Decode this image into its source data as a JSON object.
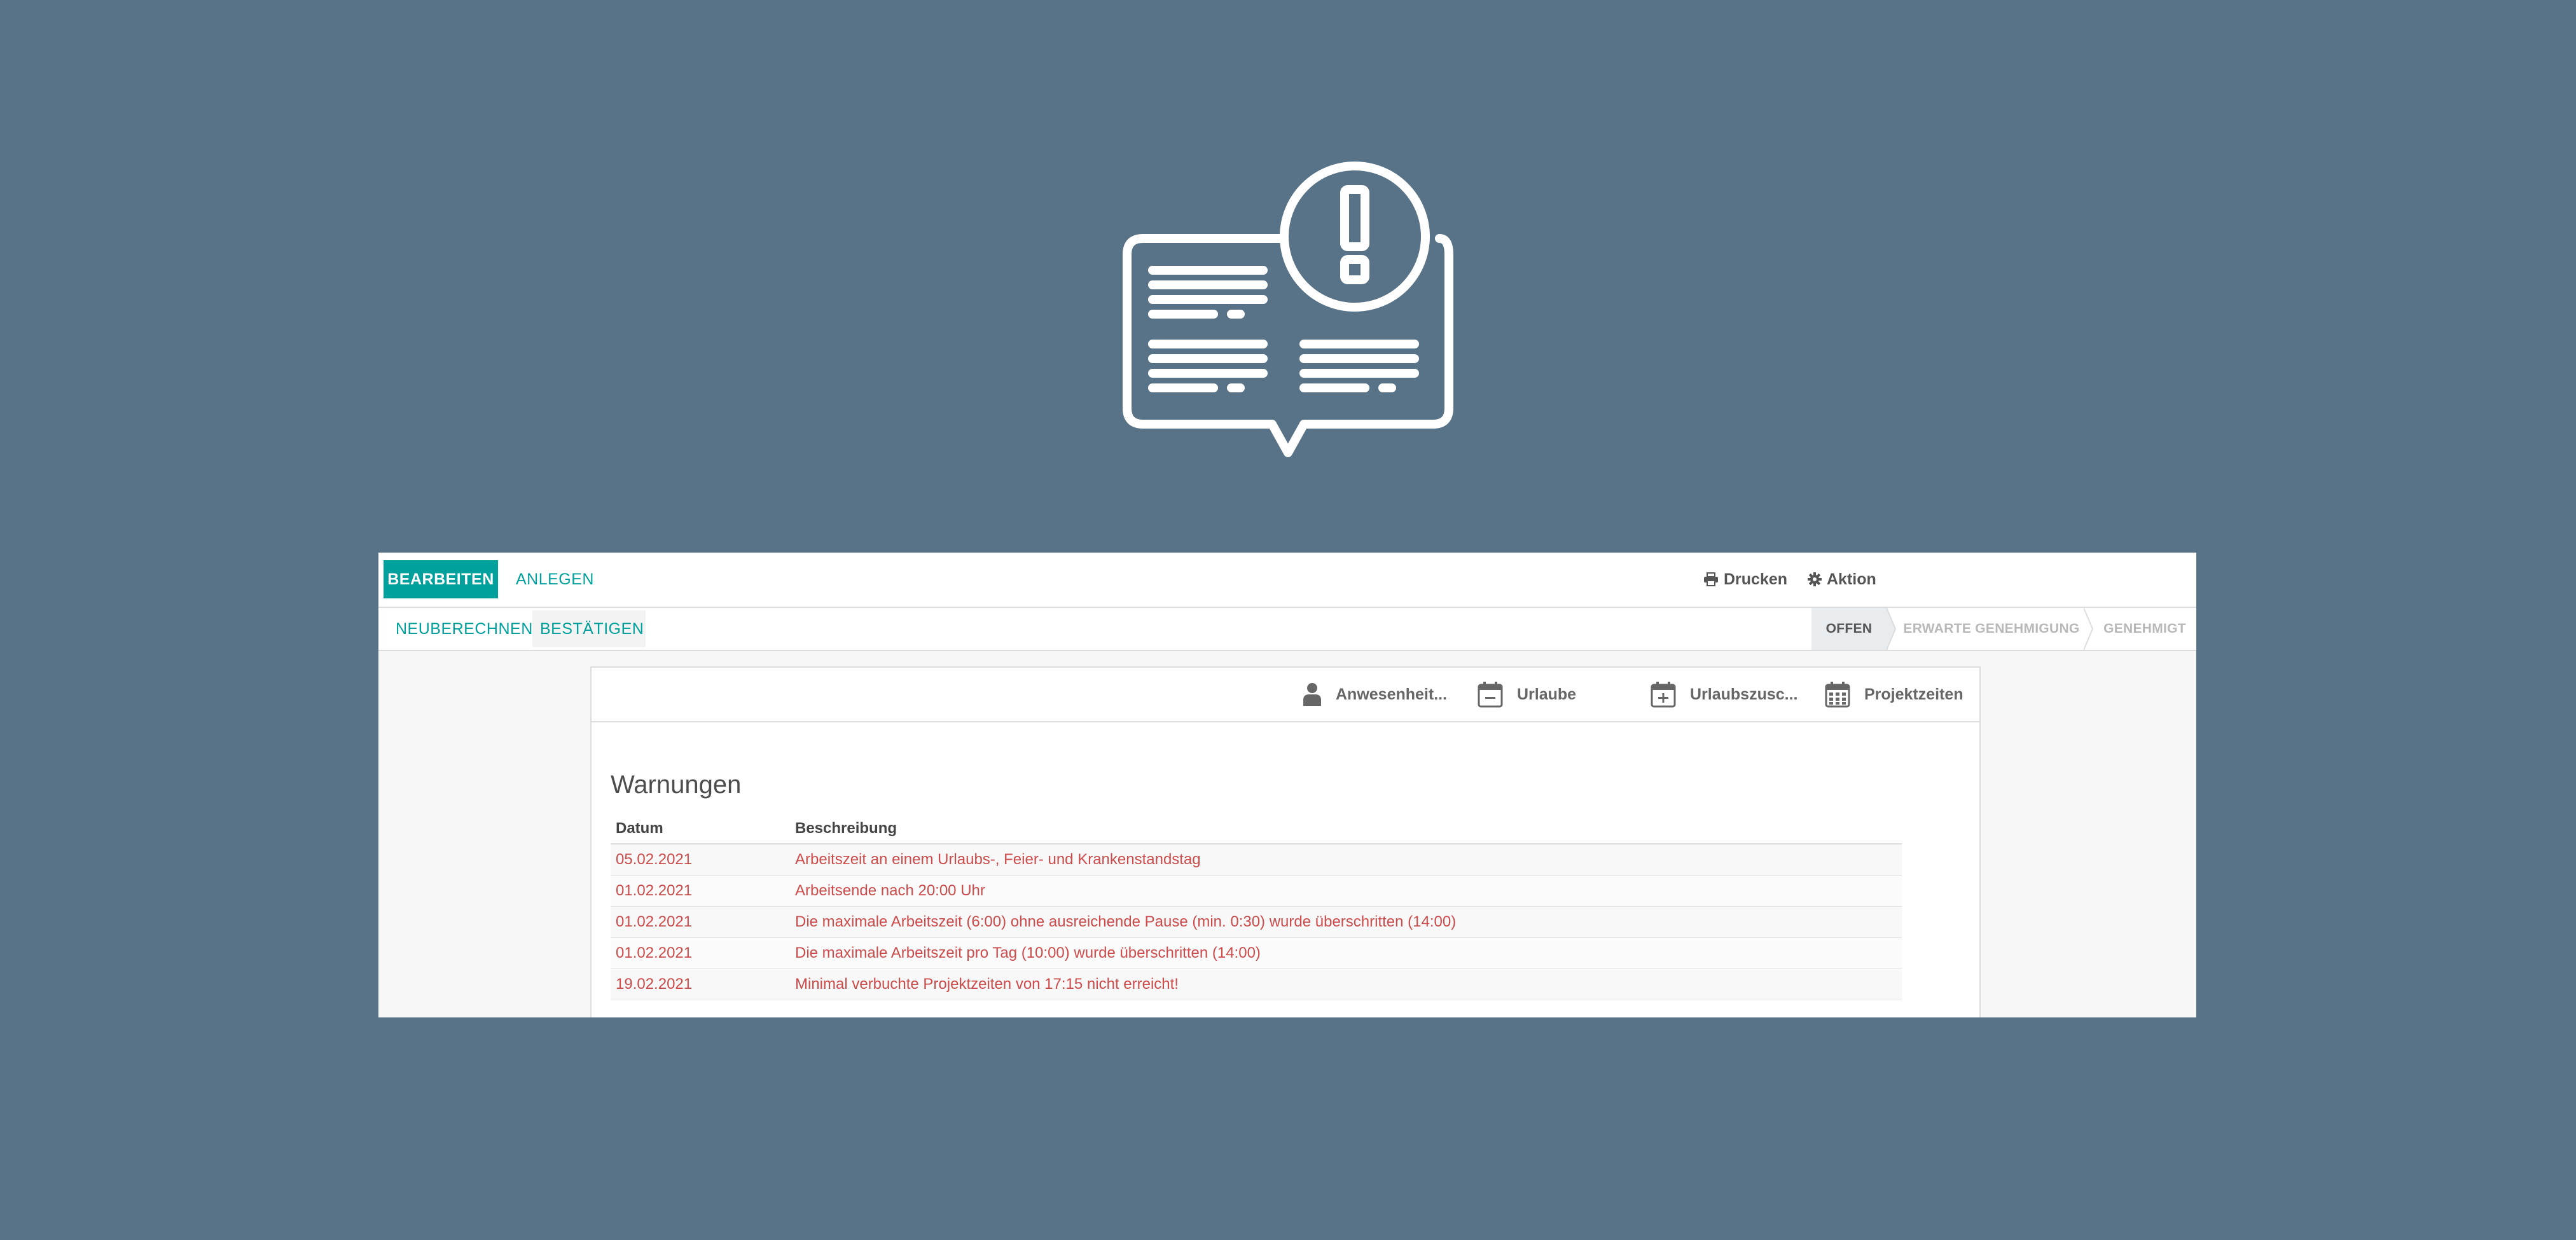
{
  "toolbar": {
    "edit_label": "BEARBEITEN",
    "create_label": "ANLEGEN",
    "print_label": "Drucken",
    "action_label": "Aktion"
  },
  "statusbar": {
    "recompute_label": "NEUBERECHNEN",
    "confirm_label": "BESTÄTIGEN",
    "stages": [
      {
        "label": "OFFEN",
        "active": true
      },
      {
        "label": "ERWARTE GENEHMIGUNG",
        "active": false
      },
      {
        "label": "GENEHMIGT",
        "active": false
      }
    ]
  },
  "smart_buttons": [
    {
      "label": "Anwesenheit...",
      "icon": "user-icon"
    },
    {
      "label": "Urlaube",
      "icon": "calendar-minus-icon"
    },
    {
      "label": "Urlaubszusc...",
      "icon": "calendar-plus-icon"
    },
    {
      "label": "Projektzeiten",
      "icon": "calendar-grid-icon"
    }
  ],
  "warnings": {
    "title": "Warnungen",
    "columns": {
      "date": "Datum",
      "description": "Beschreibung"
    },
    "rows": [
      {
        "date": "05.02.2021",
        "description": "Arbeitszeit an einem Urlaubs-, Feier- und Krankenstandstag"
      },
      {
        "date": "01.02.2021",
        "description": "Arbeitsende nach 20:00 Uhr"
      },
      {
        "date": "01.02.2021",
        "description": "Die maximale Arbeitszeit (6:00) ohne ausreichende Pause (min. 0:30) wurde überschritten (14:00)"
      },
      {
        "date": "01.02.2021",
        "description": "Die maximale Arbeitszeit pro Tag (10:00) wurde überschritten (14:00)"
      },
      {
        "date": "19.02.2021",
        "description": "Minimal verbuchte Projektzeiten von 17:15 nicht erreicht!"
      }
    ]
  },
  "colors": {
    "background": "#587287",
    "accent": "#00a09d",
    "warning_text": "#cc4b4b"
  }
}
